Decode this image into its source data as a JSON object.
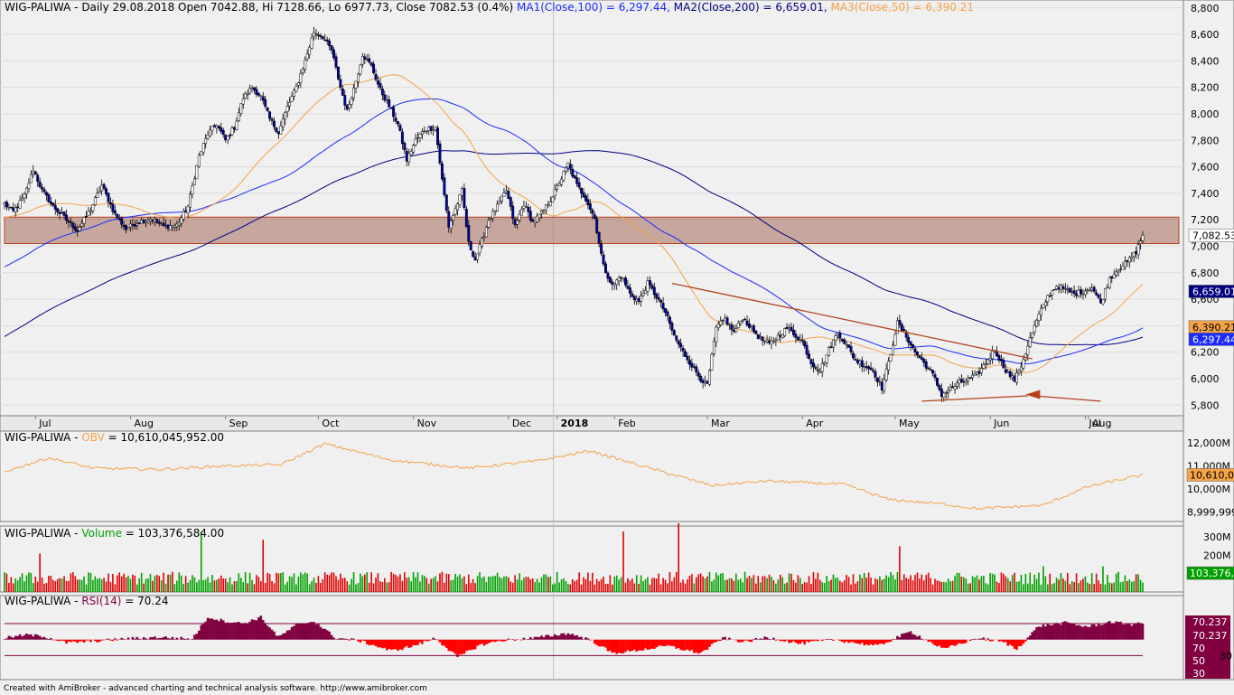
{
  "chart_data": [
    {
      "panel": "price",
      "type": "candlestick",
      "header": {
        "ticker": "WIG-PALIWA",
        "text": " - Daily 29.08.2018 Open 7042.88, Hi 7128.66, Lo 6977.73, Close 7082.53 (0.4%) ",
        "ma1_label": "MA1(Close,100) = 6,297.44,",
        "ma2_label": " MA2(Close,200) = 6,659.01,",
        "ma3_label": " MA3(Close,50) = 6,390.21"
      },
      "ylim": [
        5720,
        8860
      ],
      "y_ticks": [
        "5,800",
        "6,000",
        "6,200",
        "6,400",
        "6,600",
        "6,800",
        "7,000",
        "7,200",
        "7,400",
        "7,600",
        "7,800",
        "8,000",
        "8,200",
        "8,400",
        "8,600",
        "8,800"
      ],
      "x_labels": [
        "Jul",
        "Aug",
        "Sep",
        "Oct",
        "Nov",
        "Dec",
        "2018",
        "Feb",
        "Mar",
        "Apr",
        "May",
        "Jun",
        "Jul",
        "Aug"
      ],
      "x_label_bold_index": 6,
      "price_anchors": [
        [
          0,
          7320
        ],
        [
          4,
          7260
        ],
        [
          9,
          7380
        ],
        [
          13,
          7580
        ],
        [
          17,
          7420
        ],
        [
          22,
          7300
        ],
        [
          28,
          7200
        ],
        [
          33,
          7120
        ],
        [
          39,
          7280
        ],
        [
          44,
          7460
        ],
        [
          50,
          7240
        ],
        [
          55,
          7130
        ],
        [
          60,
          7180
        ],
        [
          66,
          7210
        ],
        [
          72,
          7150
        ],
        [
          78,
          7160
        ],
        [
          83,
          7300
        ],
        [
          88,
          7680
        ],
        [
          92,
          7850
        ],
        [
          96,
          7920
        ],
        [
          100,
          7800
        ],
        [
          104,
          7900
        ],
        [
          108,
          8120
        ],
        [
          112,
          8200
        ],
        [
          116,
          8130
        ],
        [
          120,
          7960
        ],
        [
          124,
          7860
        ],
        [
          128,
          8050
        ],
        [
          132,
          8200
        ],
        [
          136,
          8400
        ],
        [
          140,
          8620
        ],
        [
          144,
          8580
        ],
        [
          148,
          8480
        ],
        [
          152,
          8200
        ],
        [
          155,
          8020
        ],
        [
          159,
          8250
        ],
        [
          162,
          8450
        ],
        [
          166,
          8360
        ],
        [
          170,
          8180
        ],
        [
          174,
          8060
        ],
        [
          178,
          7920
        ],
        [
          182,
          7650
        ],
        [
          186,
          7800
        ],
        [
          190,
          7880
        ],
        [
          195,
          7900
        ],
        [
          198,
          7500
        ],
        [
          201,
          7150
        ],
        [
          204,
          7280
        ],
        [
          207,
          7420
        ],
        [
          210,
          7020
        ],
        [
          213,
          6900
        ],
        [
          216,
          7040
        ],
        [
          219,
          7200
        ],
        [
          223,
          7300
        ],
        [
          227,
          7420
        ],
        [
          231,
          7150
        ],
        [
          235,
          7320
        ],
        [
          239,
          7180
        ],
        [
          243,
          7250
        ],
        [
          247,
          7350
        ],
        [
          251,
          7480
        ],
        [
          255,
          7620
        ],
        [
          259,
          7460
        ],
        [
          263,
          7360
        ],
        [
          267,
          7210
        ],
        [
          271,
          6850
        ],
        [
          275,
          6700
        ],
        [
          279,
          6780
        ],
        [
          283,
          6640
        ],
        [
          287,
          6580
        ],
        [
          291,
          6720
        ],
        [
          295,
          6620
        ],
        [
          299,
          6500
        ],
        [
          303,
          6320
        ],
        [
          307,
          6200
        ],
        [
          311,
          6100
        ],
        [
          315,
          6000
        ],
        [
          318,
          5950
        ],
        [
          322,
          6380
        ],
        [
          326,
          6450
        ],
        [
          330,
          6350
        ],
        [
          334,
          6460
        ],
        [
          338,
          6380
        ],
        [
          342,
          6300
        ],
        [
          346,
          6260
        ],
        [
          350,
          6320
        ],
        [
          354,
          6380
        ],
        [
          357,
          6340
        ],
        [
          361,
          6280
        ],
        [
          365,
          6120
        ],
        [
          369,
          6060
        ],
        [
          373,
          6220
        ],
        [
          377,
          6350
        ],
        [
          381,
          6250
        ],
        [
          385,
          6140
        ],
        [
          389,
          6100
        ],
        [
          393,
          6060
        ],
        [
          397,
          5930
        ],
        [
          400,
          6120
        ],
        [
          404,
          6420
        ],
        [
          408,
          6320
        ],
        [
          412,
          6200
        ],
        [
          416,
          6120
        ],
        [
          420,
          6030
        ],
        [
          424,
          5880
        ],
        [
          428,
          5920
        ],
        [
          432,
          5970
        ],
        [
          436,
          5990
        ],
        [
          440,
          6030
        ],
        [
          444,
          6120
        ],
        [
          448,
          6220
        ],
        [
          451,
          6120
        ],
        [
          454,
          6040
        ],
        [
          457,
          5990
        ],
        [
          460,
          6100
        ],
        [
          464,
          6300
        ],
        [
          468,
          6480
        ],
        [
          472,
          6620
        ],
        [
          476,
          6700
        ],
        [
          480,
          6670
        ],
        [
          484,
          6640
        ],
        [
          488,
          6660
        ],
        [
          492,
          6690
        ],
        [
          496,
          6570
        ],
        [
          500,
          6760
        ],
        [
          504,
          6830
        ],
        [
          508,
          6880
        ],
        [
          512,
          6960
        ],
        [
          515,
          7082
        ]
      ]
    },
    {
      "panel": "obv",
      "type": "line",
      "header": {
        "ticker": "WIG-PALIWA",
        "sep": " - ",
        "name": "OBV",
        "value": " = 10,610,045,952.00"
      },
      "ylim": [
        8600,
        12500
      ],
      "y_ticks": [
        "8,999,999M",
        "10,000M",
        "11,000M",
        "12,000M"
      ],
      "last_value_label": "10,610,04",
      "anchors": [
        [
          0,
          10750
        ],
        [
          20,
          11350
        ],
        [
          40,
          10900
        ],
        [
          70,
          10850
        ],
        [
          100,
          11000
        ],
        [
          125,
          11050
        ],
        [
          145,
          11950
        ],
        [
          175,
          11250
        ],
        [
          210,
          10900
        ],
        [
          240,
          11200
        ],
        [
          265,
          11650
        ],
        [
          290,
          10950
        ],
        [
          320,
          10150
        ],
        [
          345,
          10350
        ],
        [
          380,
          10200
        ],
        [
          400,
          9550
        ],
        [
          425,
          9350
        ],
        [
          440,
          9150
        ],
        [
          470,
          9300
        ],
        [
          490,
          10100
        ],
        [
          515,
          10610
        ]
      ]
    },
    {
      "panel": "volume",
      "type": "bar",
      "header": {
        "ticker": "WIG-PALIWA",
        "sep": " - ",
        "name": "Volume",
        "value": " = 103,376,584.00"
      },
      "ylim": [
        0,
        360
      ],
      "y_ticks": [
        "100M",
        "200M",
        "300M"
      ],
      "last_value_label": "103,376,5",
      "spikes": [
        [
          16,
          210
        ],
        [
          89,
          330
        ],
        [
          117,
          285
        ],
        [
          280,
          330
        ],
        [
          305,
          375
        ],
        [
          405,
          250
        ],
        [
          470,
          140
        ],
        [
          497,
          140
        ]
      ]
    },
    {
      "panel": "rsi",
      "type": "area",
      "header": {
        "ticker": "WIG-PALIWA",
        "sep": " - ",
        "name": "RSI(14)",
        "value": " = 70.24"
      },
      "ylim": [
        0,
        105
      ],
      "levels": [
        30,
        70
      ],
      "y_ticks": [
        "30",
        "50",
        "70"
      ],
      "last_value_labels": [
        "70.237",
        "70.237"
      ],
      "anchors": [
        [
          0,
          52
        ],
        [
          10,
          56
        ],
        [
          18,
          54
        ],
        [
          28,
          46
        ],
        [
          40,
          48
        ],
        [
          55,
          51
        ],
        [
          70,
          53
        ],
        [
          85,
          51
        ],
        [
          92,
          78
        ],
        [
          100,
          73
        ],
        [
          108,
          70
        ],
        [
          116,
          78
        ],
        [
          124,
          53
        ],
        [
          132,
          68
        ],
        [
          140,
          73
        ],
        [
          150,
          52
        ],
        [
          160,
          49
        ],
        [
          175,
          36
        ],
        [
          185,
          42
        ],
        [
          195,
          52
        ],
        [
          205,
          28
        ],
        [
          215,
          43
        ],
        [
          225,
          49
        ],
        [
          240,
          52
        ],
        [
          255,
          58
        ],
        [
          265,
          50
        ],
        [
          275,
          33
        ],
        [
          285,
          36
        ],
        [
          300,
          42
        ],
        [
          315,
          33
        ],
        [
          325,
          52
        ],
        [
          335,
          47
        ],
        [
          345,
          53
        ],
        [
          360,
          45
        ],
        [
          375,
          50
        ],
        [
          395,
          42
        ],
        [
          410,
          60
        ],
        [
          425,
          38
        ],
        [
          440,
          52
        ],
        [
          452,
          47
        ],
        [
          458,
          38
        ],
        [
          468,
          67
        ],
        [
          480,
          71
        ],
        [
          490,
          66
        ],
        [
          500,
          72
        ],
        [
          510,
          69
        ],
        [
          515,
          70
        ]
      ]
    }
  ],
  "trendlines": [
    {
      "from": [
        302,
        6720
      ],
      "to": [
        465,
        6150
      ],
      "color": "#b5421a"
    },
    {
      "from": [
        415,
        5830
      ],
      "to": [
        463,
        5870
      ],
      "color": "#b5421a"
    },
    {
      "from": [
        466,
        5870
      ],
      "to": [
        496,
        5830
      ],
      "color": "#b5421a"
    }
  ],
  "zone": {
    "from_price": 7020,
    "to_price": 7220
  },
  "price_tags": [
    {
      "label": "7,082.53",
      "price": 7082.53,
      "bg": "#ffffff",
      "fg": "#000000"
    },
    {
      "label": "6,659.01",
      "price": 6659.01,
      "bg": "#000080",
      "fg": "#ffffff"
    },
    {
      "label": "6,390.21",
      "price": 6390.21,
      "bg": "#f5a347",
      "fg": "#000000"
    },
    {
      "label": "6,297.44",
      "price": 6297.44,
      "bg": "#1b2bff",
      "fg": "#ffffff"
    }
  ],
  "colors": {
    "up_candle": "#ffffff",
    "down_candle": "#0000a0",
    "wick": "#000000",
    "ma100": "#1b2bff",
    "ma200": "#000080",
    "ma50": "#f5a347",
    "zone_fill": "#b08070",
    "zone_stroke": "#b5421a",
    "vol_up": "#00a000",
    "vol_down": "#e00000",
    "rsi_pos": "#800040",
    "rsi_neg": "#ff0000",
    "rsi_level": "#800040",
    "obv_line": "#f5a347",
    "panel_bg": "#f0f0f0",
    "axis_text": "#000000",
    "header_bg": "#d8d8d8",
    "ma3_label_color": "#f5a347",
    "volume_label_color": "#00a000"
  },
  "footer": "Created with AmiBroker - advanced charting and technical analysis software. http://www.amibroker.com"
}
